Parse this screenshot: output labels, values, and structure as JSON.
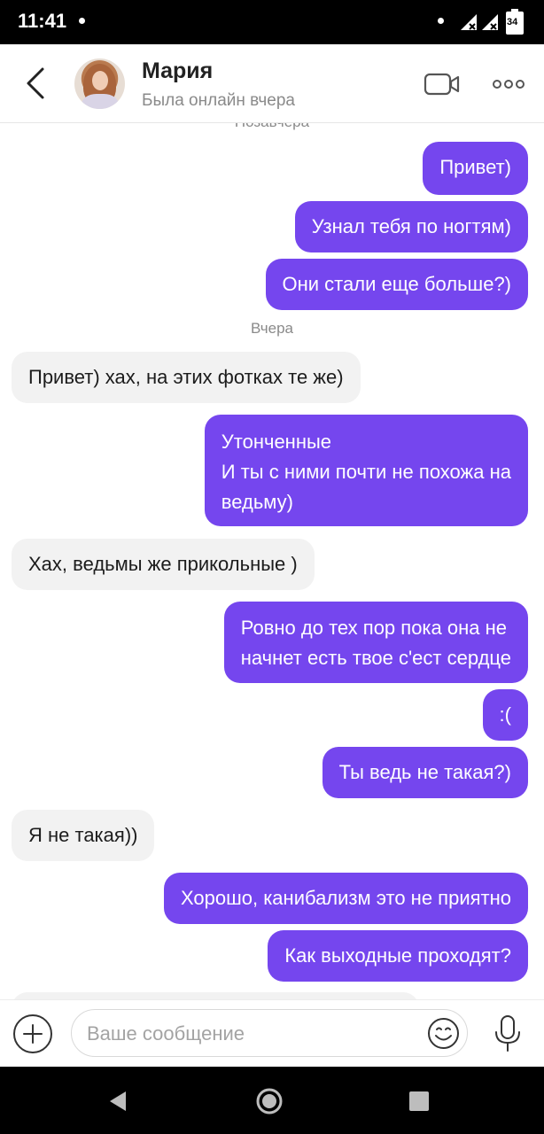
{
  "status_bar": {
    "time": "11:41",
    "battery": "34"
  },
  "header": {
    "contact_name": "Мария",
    "contact_status": "Была онлайн вчера"
  },
  "chat": {
    "cut_day_label": "Позавчера",
    "day_label": "Вчера",
    "messages": [
      {
        "direction": "out",
        "lines": [
          "Привет)"
        ]
      },
      {
        "direction": "out",
        "lines": [
          "Узнал тебя по ногтям)"
        ]
      },
      {
        "direction": "out",
        "lines": [
          "Они стали еще больше?)"
        ]
      },
      {
        "direction": "in",
        "lines": [
          "Привет) хах, на этих фотках те же)"
        ]
      },
      {
        "direction": "out",
        "lines": [
          "Утонченные",
          "И ты с ними почти не похожа на",
          "ведьму)"
        ]
      },
      {
        "direction": "in",
        "lines": [
          "Хах, ведьмы же прикольные )"
        ]
      },
      {
        "direction": "out",
        "lines": [
          "Ровно до тех пор пока она не",
          "начнет есть твое с'ест сердце"
        ]
      },
      {
        "direction": "out",
        "lines": [
          ":("
        ]
      },
      {
        "direction": "out",
        "lines": [
          "Ты ведь не такая?)"
        ]
      },
      {
        "direction": "in",
        "lines": [
          "Я не такая))"
        ]
      },
      {
        "direction": "out",
        "lines": [
          "Хорошо, канибализм это не приятно"
        ]
      },
      {
        "direction": "out",
        "lines": [
          "Как выходные проходят?"
        ]
      }
    ]
  },
  "composer": {
    "placeholder": "Ваше сообщение"
  },
  "icons": {
    "back": "chevron-left-icon",
    "video": "video-camera-icon",
    "more": "more-dots-icon",
    "attach": "plus-circle-icon",
    "emoji": "smiley-icon",
    "mic": "microphone-icon"
  },
  "colors": {
    "outgoing_bubble": "#7546ee",
    "incoming_bubble": "#f2f2f2",
    "status_bar": "#000000"
  }
}
